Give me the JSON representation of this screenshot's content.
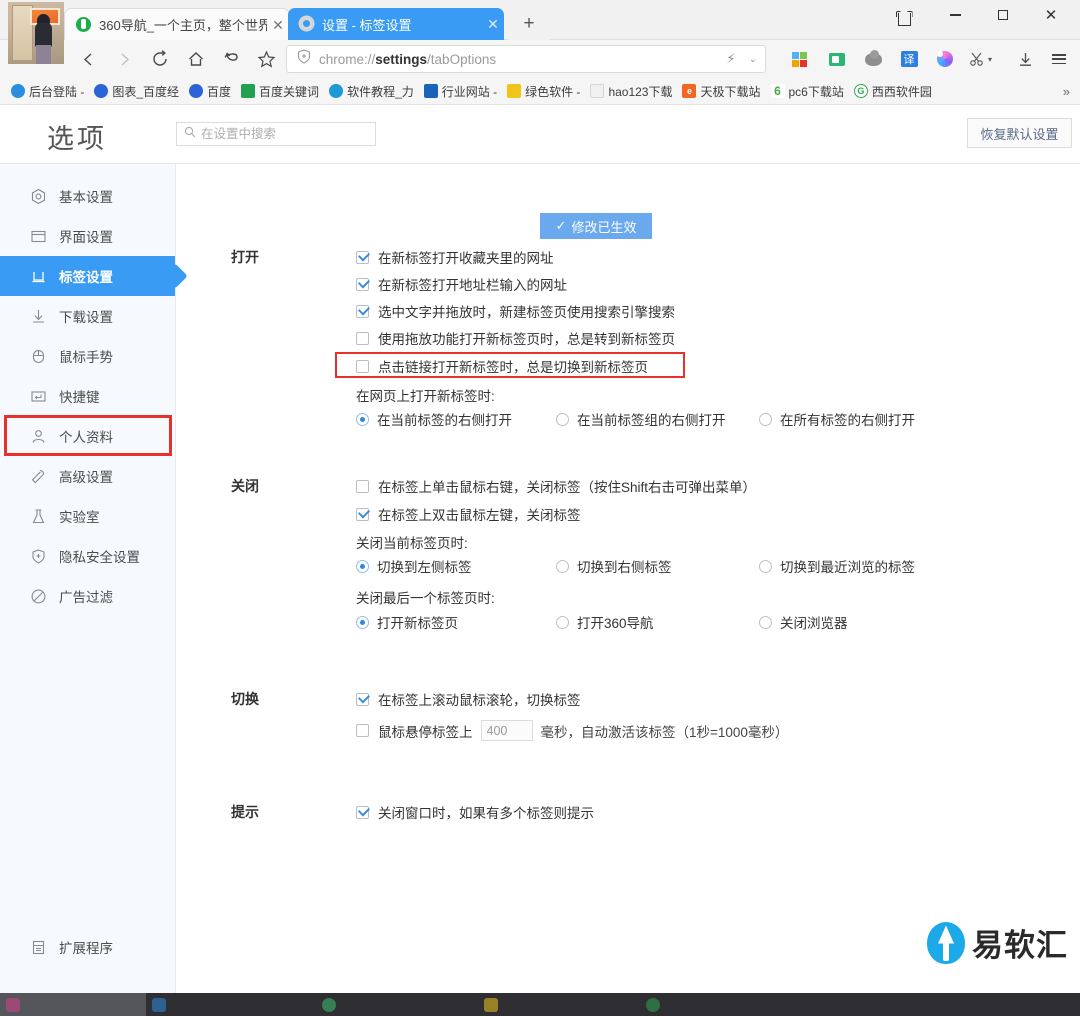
{
  "window": {
    "controls": [
      {
        "name": "skin-button",
        "icon": "tshirt-icon",
        "label": ""
      },
      {
        "name": "minimize-button",
        "icon": "minimize-icon",
        "label": ""
      },
      {
        "name": "maximize-button",
        "icon": "maximize-icon",
        "label": ""
      },
      {
        "name": "close-button",
        "icon": "close-icon",
        "label": "✕"
      }
    ]
  },
  "tabs": [
    {
      "title": "360导航_一个主页，整个世界",
      "favicon": "360-logo-icon",
      "active": false,
      "close": "✕"
    },
    {
      "title": "设置 - 标签设置",
      "favicon": "gear-icon",
      "active": true,
      "close": "✕"
    }
  ],
  "newtab": {
    "label": "+"
  },
  "toolbar": {
    "back": "‹",
    "forward": "›",
    "reload": "↻",
    "home": "⌂",
    "undo": "↩",
    "bookmark_star": "☆",
    "url_prefix": "chrome://",
    "url_bold": "settings",
    "url_suffix": "/tabOptions",
    "url_full": "chrome://settings/tabOptions",
    "shield_icon": "shield-icon",
    "bolt_icon": "lightning-icon",
    "chevron": "⌄",
    "icons": [
      {
        "name": "apps-grid-icon",
        "glyph": "grid"
      },
      {
        "name": "wallet-icon",
        "glyph": "money"
      },
      {
        "name": "cloud-icon",
        "glyph": "cloud"
      },
      {
        "name": "translate-icon",
        "glyph": "译"
      },
      {
        "name": "ai-swirl-icon",
        "glyph": "swirl"
      },
      {
        "name": "screenshot-scissors-icon",
        "glyph": "✂"
      },
      {
        "name": "scissors-dropdown-icon",
        "glyph": "▾"
      },
      {
        "name": "download-icon",
        "glyph": "↧"
      },
      {
        "name": "main-menu-icon",
        "glyph": "hamburger"
      }
    ]
  },
  "bookmarks": {
    "items": [
      {
        "label": "后台登陆 -",
        "icon_color": "#2b8de0",
        "icon_text": ""
      },
      {
        "label": "图表_百度经",
        "icon_color": "#2c63d6",
        "icon_text": ""
      },
      {
        "label": "百度",
        "icon_color": "#2c63d6",
        "icon_text": ""
      },
      {
        "label": "百度关键词",
        "icon_color": "#21a050",
        "icon_text": ""
      },
      {
        "label": "软件教程_力",
        "icon_color": "#1f9ad6",
        "icon_text": ""
      },
      {
        "label": "行业网站 -",
        "icon_color": "#1b63b8",
        "icon_text": ""
      },
      {
        "label": "绿色软件 -",
        "icon_color": "#f0c419",
        "icon_text": ""
      },
      {
        "label": "hao123下载",
        "icon_color": "#e8e8e8",
        "icon_text": ""
      },
      {
        "label": "天极下载站",
        "icon_color": "#f26522",
        "icon_text": "e"
      },
      {
        "label": "pc6下载站",
        "icon_color": "#ffffff",
        "icon_text": "6"
      },
      {
        "label": "西西软件园",
        "icon_color": "#2fa84f",
        "icon_text": "G"
      }
    ],
    "overflow": "»"
  },
  "settings_page": {
    "title": "选项",
    "search_placeholder": "在设置中搜索",
    "search_value": "",
    "search_icon": "search-icon",
    "toast": {
      "check": "✓",
      "text": "修改已生效",
      "color": "#6aa9ee"
    },
    "reset_button": "恢复默认设置",
    "sidebar": {
      "items": [
        {
          "label": "基本设置",
          "icon": "target-icon",
          "active": false
        },
        {
          "label": "界面设置",
          "icon": "window-icon",
          "active": false
        },
        {
          "label": "标签设置",
          "icon": "tab-icon",
          "active": true
        },
        {
          "label": "下载设置",
          "icon": "download-icon",
          "active": false
        },
        {
          "label": "鼠标手势",
          "icon": "mouse-icon",
          "active": false
        },
        {
          "label": "快捷键",
          "icon": "keyboard-icon",
          "active": false
        },
        {
          "label": "个人资料",
          "icon": "person-icon",
          "active": false
        },
        {
          "label": "高级设置",
          "icon": "wrench-icon",
          "active": false
        },
        {
          "label": "实验室",
          "icon": "flask-icon",
          "active": false
        },
        {
          "label": "隐私安全设置",
          "icon": "shield-icon",
          "active": false
        },
        {
          "label": "广告过滤",
          "icon": "block-icon",
          "active": false
        }
      ],
      "footer": {
        "label": "扩展程序",
        "icon": "extension-icon"
      }
    },
    "sections": [
      {
        "label": "打开",
        "checkboxes": [
          {
            "label": "在新标签打开收藏夹里的网址",
            "checked": true
          },
          {
            "label": "在新标签打开地址栏输入的网址",
            "checked": true
          },
          {
            "label": "选中文字并拖放时，新建标签页使用搜索引擎搜索",
            "checked": true
          },
          {
            "label": "使用拖放功能打开新标签页时，总是转到新标签页",
            "checked": false
          },
          {
            "label": "点击链接打开新标签时，总是切换到新标签页",
            "checked": false,
            "annotated": true
          }
        ],
        "radio_groups": [
          {
            "label": "在网页上打开新标签时:",
            "options": [
              {
                "label": "在当前标签的右侧打开",
                "selected": true
              },
              {
                "label": "在当前标签组的右侧打开",
                "selected": false
              },
              {
                "label": "在所有标签的右侧打开",
                "selected": false
              }
            ]
          }
        ]
      },
      {
        "label": "关闭",
        "checkboxes": [
          {
            "label": "在标签上单击鼠标右键，关闭标签（按住Shift右击可弹出菜单）",
            "checked": false
          },
          {
            "label": "在标签上双击鼠标左键，关闭标签",
            "checked": true
          }
        ],
        "radio_groups": [
          {
            "label": "关闭当前标签页时:",
            "options": [
              {
                "label": "切换到左侧标签",
                "selected": true
              },
              {
                "label": "切换到右侧标签",
                "selected": false
              },
              {
                "label": "切换到最近浏览的标签",
                "selected": false
              }
            ]
          },
          {
            "label": "关闭最后一个标签页时:",
            "options": [
              {
                "label": "打开新标签页",
                "selected": true
              },
              {
                "label": "打开360导航",
                "selected": false
              },
              {
                "label": "关闭浏览器",
                "selected": false
              }
            ]
          }
        ]
      },
      {
        "label": "切换",
        "checkboxes": [
          {
            "label": "在标签上滚动鼠标滚轮，切换标签",
            "checked": true
          }
        ],
        "hover_row": {
          "checked": false,
          "prefix": "鼠标悬停标签上",
          "value": "400",
          "suffix": "毫秒，自动激活该标签（1秒=1000毫秒）"
        }
      },
      {
        "label": "提示",
        "checkboxes": [
          {
            "label": "关闭窗口时，如果有多个标签则提示",
            "checked": true
          }
        ]
      }
    ]
  },
  "watermark": {
    "text": "易软汇",
    "logo": "yiruanhui-logo-icon"
  },
  "taskbar": {
    "items": [
      {
        "label": "",
        "color": "#d93f8c"
      },
      {
        "label": "",
        "color": "#2b8de0"
      },
      {
        "label": "",
        "color": "#3ec46d"
      },
      {
        "label": "",
        "color": "#f0c419"
      },
      {
        "label": "",
        "color": "#2fa84f"
      }
    ]
  }
}
